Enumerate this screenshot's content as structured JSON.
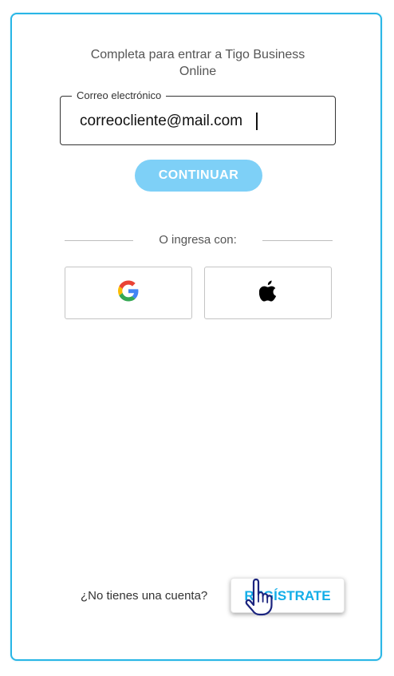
{
  "login": {
    "intro_line1": "Completa para entrar a Tigo Business",
    "intro_line2": "Online",
    "email_label": "Correo electrónico",
    "email_value": "correocliente@mail.com",
    "continue_label": "CONTINUAR",
    "alt_login_label": "O ingresa con:",
    "social": [
      {
        "name": "google",
        "icon": "google-icon"
      },
      {
        "name": "apple",
        "icon": "apple-icon"
      }
    ]
  },
  "footer": {
    "no_account_text": "¿No tienes una cuenta?",
    "register_label": "REGÍSTRATE"
  },
  "colors": {
    "accent": "#29b6e6",
    "continue_button": "#7ed0f7",
    "register_text": "#13aee8"
  },
  "cursor": "hand-pointer-icon"
}
